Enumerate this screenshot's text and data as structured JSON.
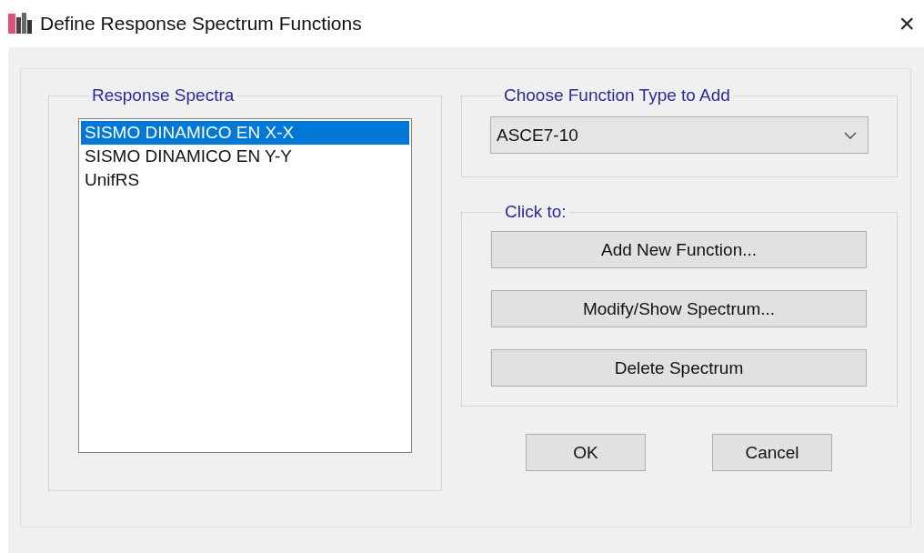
{
  "window": {
    "title": "Define Response Spectrum Functions",
    "close": "×"
  },
  "response_spectra": {
    "label": "Response Spectra",
    "items": [
      {
        "text": "SISMO DINAMICO EN X-X",
        "selected": true
      },
      {
        "text": "SISMO DINAMICO EN Y-Y",
        "selected": false
      },
      {
        "text": "UnifRS",
        "selected": false
      }
    ]
  },
  "function_type": {
    "label": "Choose  Function Type to Add",
    "value": "ASCE7-10"
  },
  "click_to": {
    "label": "Click to:",
    "buttons": [
      "Add New Function...",
      "Modify/Show Spectrum...",
      "Delete Spectrum"
    ]
  },
  "buttons": [
    "OK",
    "Cancel"
  ]
}
